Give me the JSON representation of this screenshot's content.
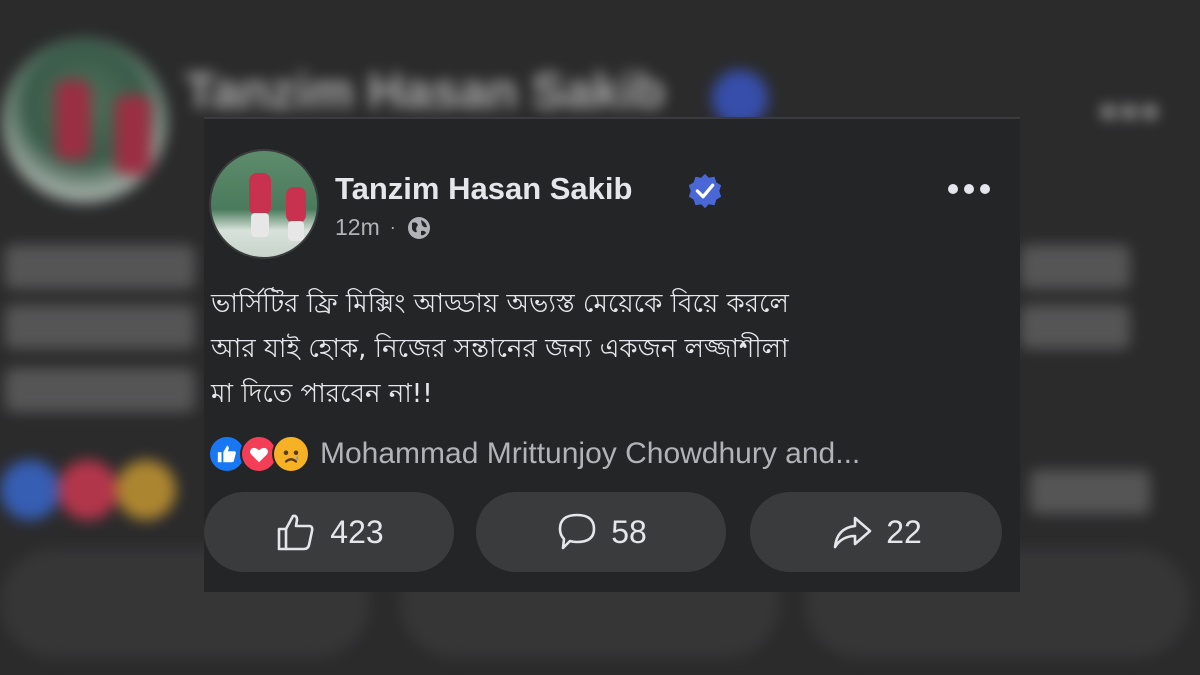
{
  "post": {
    "author": "Tanzim Hasan Sakib",
    "time": "12m",
    "separator": "·",
    "text_lines": [
      "ভার্সিটির ফ্রি মিক্সিং আড্ডায় অভ্যস্ত মেয়েকে বিয়ে করলে",
      "আর যাই হোক, নিজের সন্তানের জন্য একজন লজ্জাশীলা",
      "মা দিতে পারবেন না!!"
    ],
    "reactions_text": "Mohammad Mrittunjoy Chowdhury and...",
    "reaction_icons": [
      "like-icon",
      "love-icon",
      "sad-icon"
    ]
  },
  "actions": {
    "like_count": "423",
    "comment_count": "58",
    "share_count": "22"
  },
  "colors": {
    "like_blue": "#1877f2",
    "love_red": "#f33e58",
    "sad_yellow": "#f7b125",
    "verified_blue": "#4a67d6"
  }
}
